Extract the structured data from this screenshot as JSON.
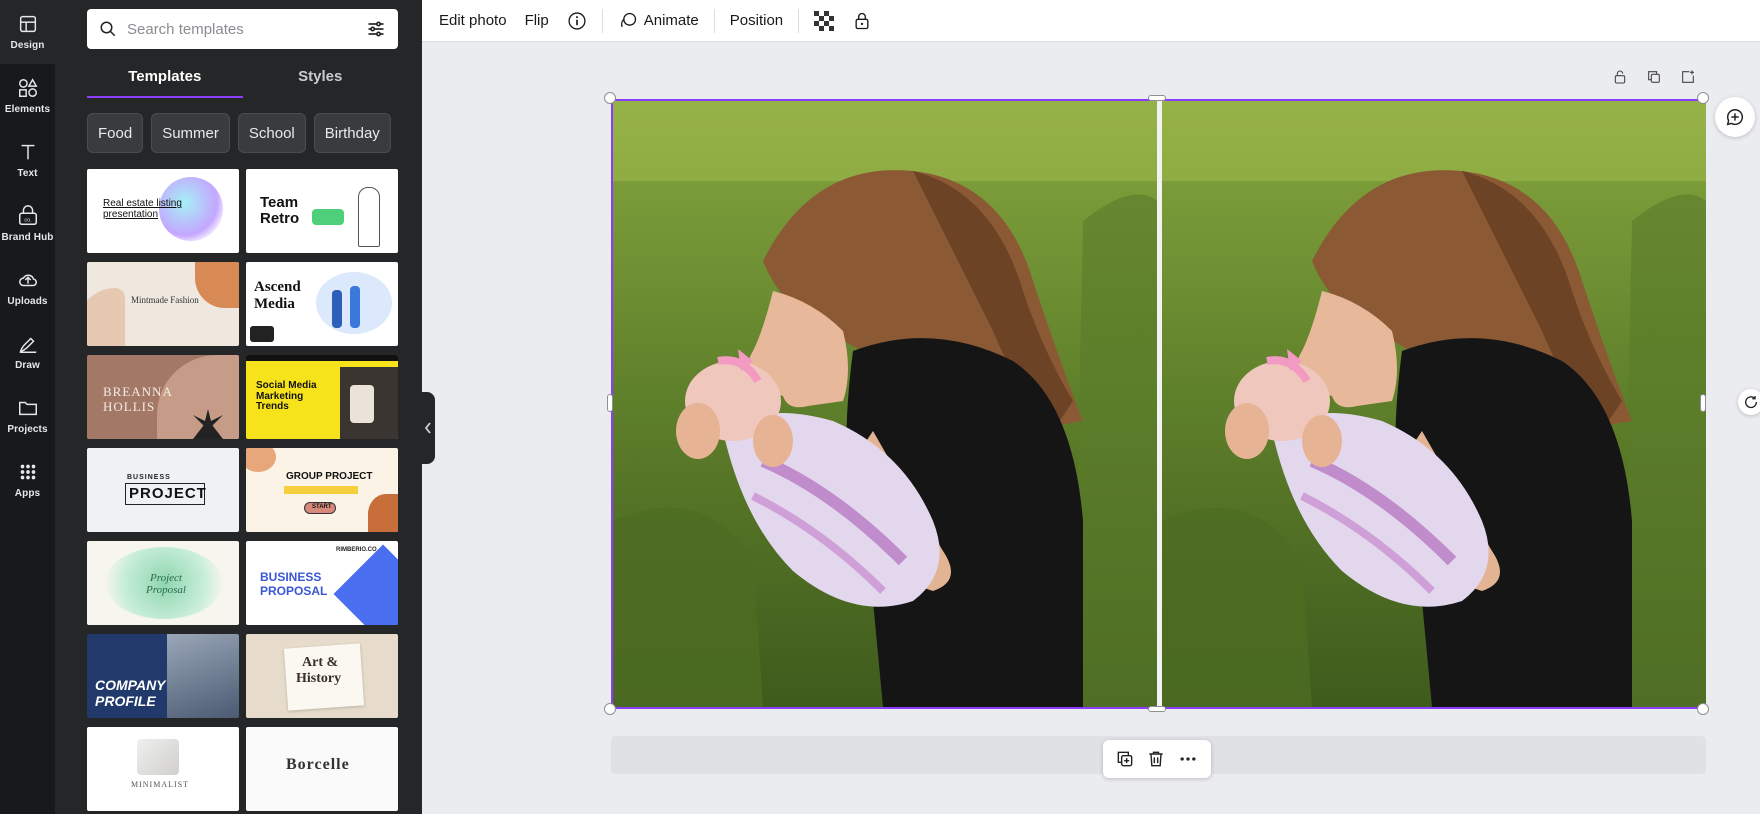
{
  "rail": {
    "items": [
      {
        "label": "Design",
        "icon": "layout-icon"
      },
      {
        "label": "Elements",
        "icon": "shapes-icon"
      },
      {
        "label": "Text",
        "icon": "text-icon"
      },
      {
        "label": "Brand Hub",
        "icon": "brand-icon"
      },
      {
        "label": "Uploads",
        "icon": "cloud-upload-icon"
      },
      {
        "label": "Draw",
        "icon": "pen-icon"
      },
      {
        "label": "Projects",
        "icon": "folder-icon"
      },
      {
        "label": "Apps",
        "icon": "apps-grid-icon"
      }
    ]
  },
  "panel": {
    "search_placeholder": "Search templates",
    "tabs": [
      {
        "label": "Templates"
      },
      {
        "label": "Styles"
      }
    ],
    "chips": [
      {
        "label": "Food"
      },
      {
        "label": "Summer"
      },
      {
        "label": "School"
      },
      {
        "label": "Birthday"
      }
    ],
    "templates": {
      "t1": "Real estate listing presentation",
      "t2a": "Team",
      "t2b": "Retro",
      "t3": "Mintmade Fashion",
      "t4a": "Ascend",
      "t4b": "Media",
      "t5a": "BREANNA",
      "t5b": "HOLLIS",
      "t6": "Social Media Marketing Trends",
      "t7a": "BUSINESS",
      "t7b": "PROJECT",
      "t8a": "GROUP PROJECT",
      "t8b": "START",
      "t9": "Project Proposal",
      "t10a": "BUSINESS",
      "t10b": "PROPOSAL",
      "t10c": "RIMBERIO.CO",
      "t11a": "COMPANY",
      "t11b": "PROFILE",
      "t12a": "Art &",
      "t12b": "History",
      "t13": "MINIMALIST",
      "t14": "Borcelle"
    }
  },
  "toolbar": {
    "edit_photo": "Edit photo",
    "flip": "Flip",
    "animate": "Animate",
    "position": "Position"
  },
  "colors": {
    "accent": "#8b3dff",
    "rail_bg": "#18191b",
    "panel_bg": "#252627",
    "canvas_bg": "#ebecf0"
  }
}
